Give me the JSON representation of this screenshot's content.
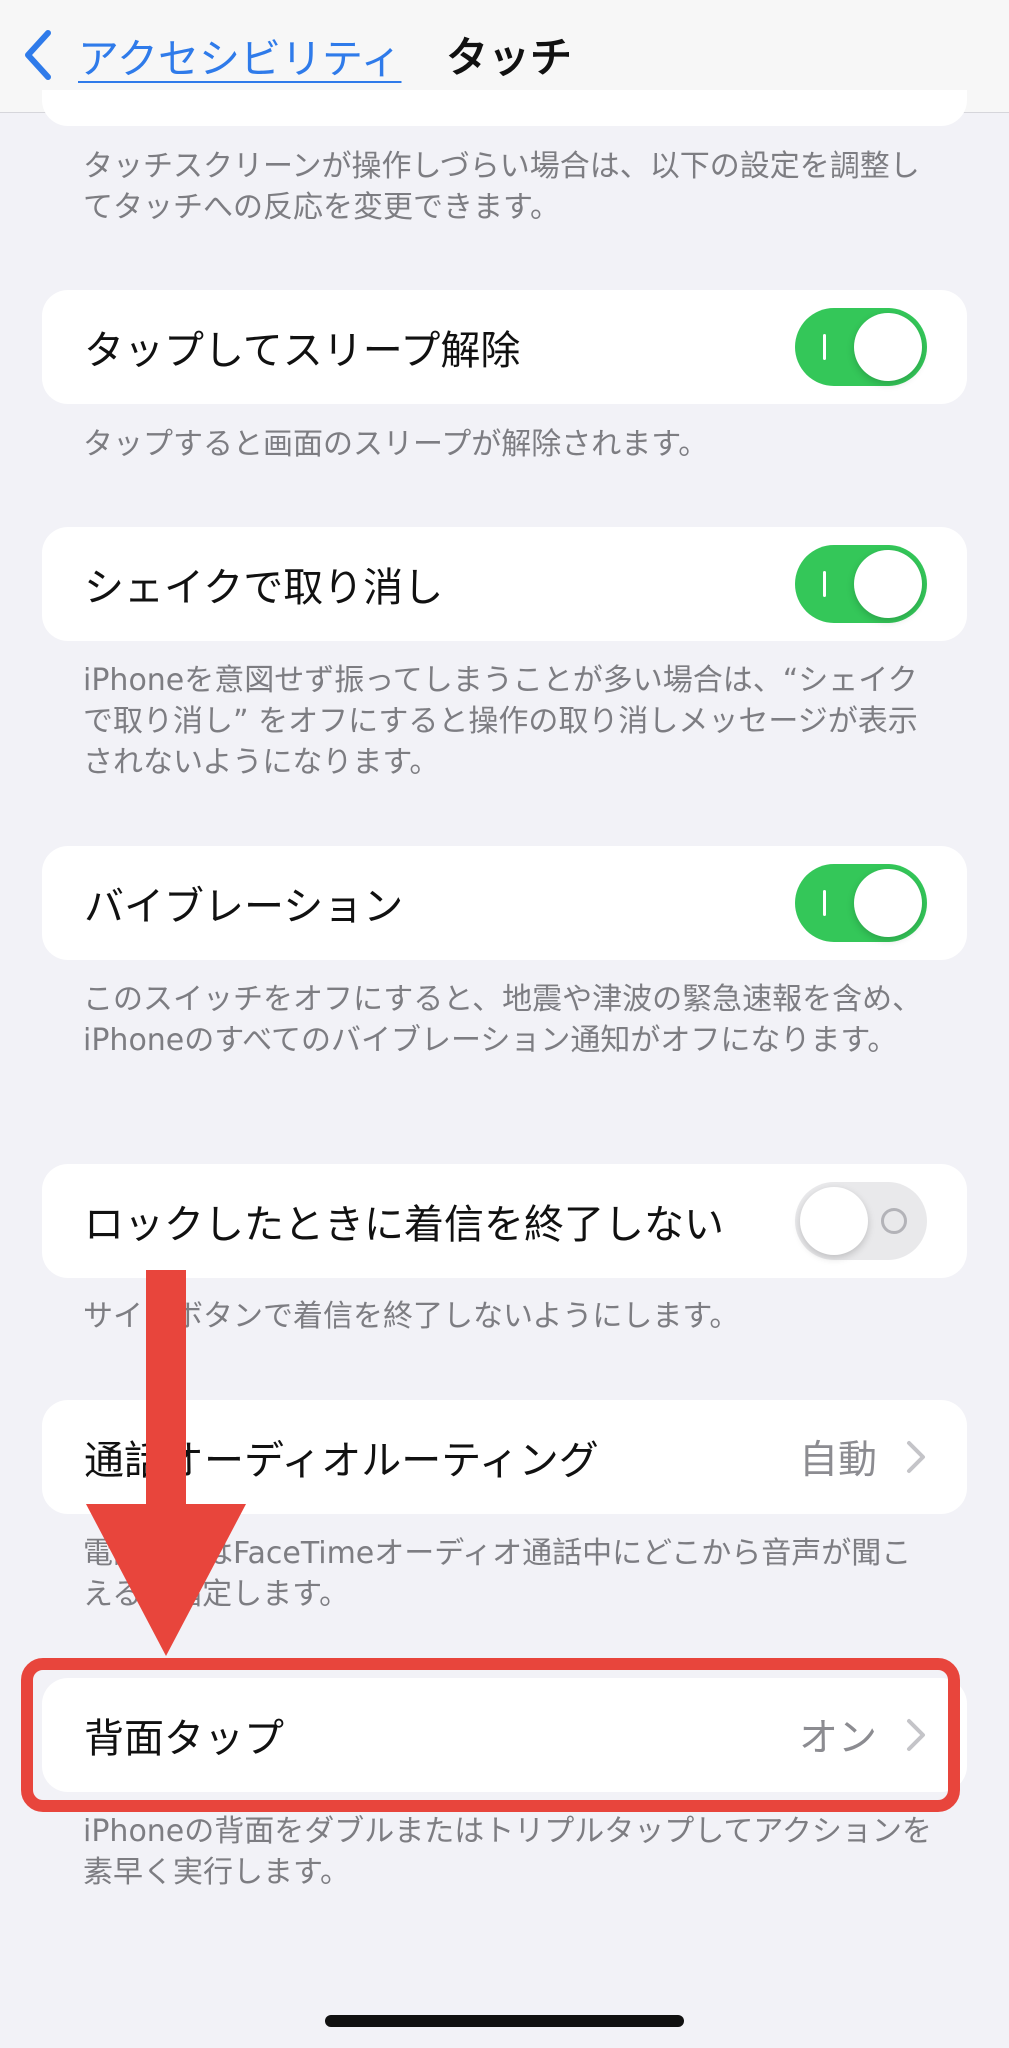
{
  "nav": {
    "back_label": "アクセシビリティ",
    "title": "タッチ"
  },
  "intro_text": "タッチスクリーンが操作しづらい場合は、以下の設定を調整してタッチへの反応を変更できます。",
  "settings": {
    "tap_to_wake": {
      "label": "タップしてスリープ解除",
      "state": "on",
      "footer": "タップすると画面のスリープが解除されます。"
    },
    "shake_to_undo": {
      "label": "シェイクで取り消し",
      "state": "on",
      "footer": "iPhoneを意図せず振ってしまうことが多い場合は、“シェイクで取り消し” をオフにすると操作の取り消しメッセージが表示されないようになります。"
    },
    "vibration": {
      "label": "バイブレーション",
      "state": "on",
      "footer": "このスイッチをオフにすると、地震や津波の緊急速報を含め、iPhoneのすべてのバイブレーション通知がオフになります。"
    },
    "prevent_lock_to_end_call": {
      "label": "ロックしたときに着信を終了しない",
      "state": "off",
      "footer": "サイドボタンで着信を終了しないようにします。"
    },
    "call_audio_routing": {
      "label": "通話オーディオルーティング",
      "value": "自動",
      "footer": "電話またはFaceTimeオーディオ通話中にどこから音声が聞こえるか指定します。"
    },
    "back_tap": {
      "label": "背面タップ",
      "value": "オン",
      "footer": "iPhoneの背面をダブルまたはトリプルタップしてアクションを素早く実行します。"
    }
  },
  "colors": {
    "accent": "#2f7bea",
    "toggle_on": "#34c759",
    "annotation": "#e8453c",
    "background": "#f2f2f7"
  },
  "icons": {
    "back": "chevron-left-icon",
    "disclosure": "chevron-right-icon",
    "annotation_arrow": "down-arrow-icon"
  }
}
